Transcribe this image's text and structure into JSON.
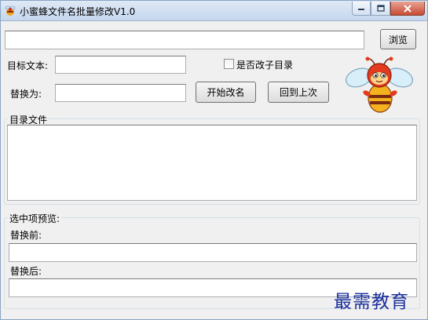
{
  "window": {
    "title": "小蜜蜂文件名批量修改V1.0"
  },
  "path_row": {
    "path_value": "",
    "browse_label": "浏览"
  },
  "target": {
    "label": "目标文本:",
    "value": ""
  },
  "subdir": {
    "label": "是否改子目录",
    "checked": false
  },
  "replace": {
    "label": "替换为:",
    "value": ""
  },
  "actions": {
    "start_label": "开始改名",
    "undo_label": "回到上次"
  },
  "dir_files": {
    "title": "目录文件",
    "items": []
  },
  "preview": {
    "title": "选中项预览:",
    "before_label": "替换前:",
    "before_value": "",
    "after_label": "替换后:",
    "after_value": ""
  },
  "watermark": "最需教育",
  "icons": {
    "app": "bee-icon",
    "mascot": "bee-mascot"
  },
  "colors": {
    "titlebar": "#c6d7ee",
    "close_button": "#c84b34",
    "watermark": "#1a2f9c"
  }
}
